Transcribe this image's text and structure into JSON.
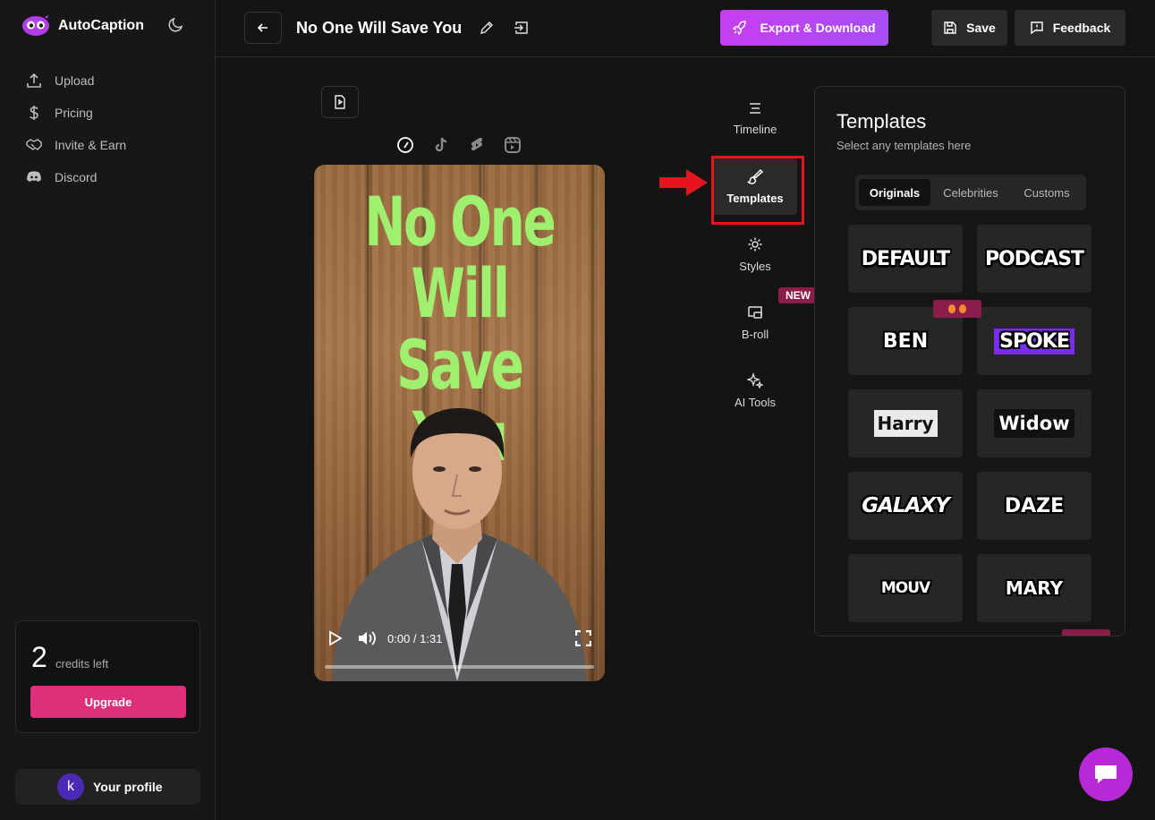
{
  "app": {
    "name": "AutoCaption"
  },
  "sidebar": {
    "items": [
      {
        "label": "Upload",
        "icon": "upload-icon"
      },
      {
        "label": "Pricing",
        "icon": "dollar-icon"
      },
      {
        "label": "Invite & Earn",
        "icon": "handshake-icon"
      },
      {
        "label": "Discord",
        "icon": "discord-icon"
      }
    ],
    "credits_count": "2",
    "credits_label": "credits left",
    "upgrade_label": "Upgrade",
    "profile_initial": "k",
    "profile_label": "Your profile"
  },
  "header": {
    "project_title": "No One Will Save You",
    "export_label": "Export & Download",
    "save_label": "Save",
    "feedback_label": "Feedback"
  },
  "player": {
    "caption_lines": [
      "No One",
      "Will Save",
      "You"
    ],
    "time": "0:00 / 1:31",
    "platforms": [
      "compass-icon",
      "tiktok-icon",
      "youtube-shorts-icon",
      "instagram-reels-icon"
    ]
  },
  "tools": {
    "items": [
      {
        "label": "Timeline",
        "icon": "timeline-icon"
      },
      {
        "label": "Templates",
        "icon": "brush-icon",
        "active": true
      },
      {
        "label": "Styles",
        "icon": "gear-icon"
      },
      {
        "label": "B-roll",
        "icon": "broll-icon"
      },
      {
        "label": "AI Tools",
        "icon": "sparkles-icon"
      }
    ],
    "new_badge": "NEW"
  },
  "templates_panel": {
    "title": "Templates",
    "subtitle": "Select any templates here",
    "tabs": [
      "Originals",
      "Celebrities",
      "Customs"
    ],
    "active_tab": "Originals",
    "items": [
      "DEFAULT",
      "PODCAST",
      "BEN",
      "SPOKE",
      "Harry",
      "Widow",
      "GALAXY",
      "DAZE",
      "MOUV",
      "MARY"
    ]
  },
  "colors": {
    "accent": "#b729d6",
    "upgrade": "#de2f7a",
    "caption": "#9ff06f",
    "highlight": "#e6151d"
  }
}
